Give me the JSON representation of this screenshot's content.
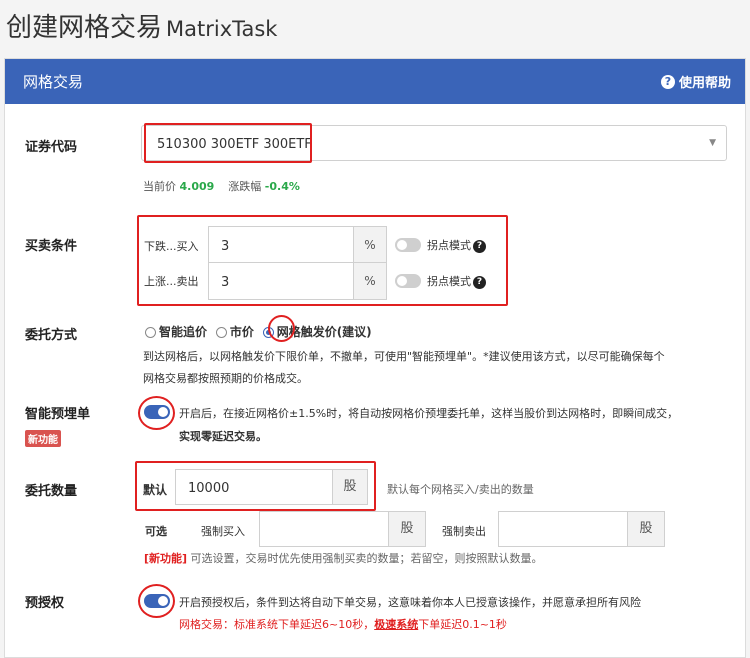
{
  "page": {
    "title_cn": "创建网格交易",
    "title_en": "MatrixTask"
  },
  "card": {
    "title": "网格交易",
    "help_label": "使用帮助"
  },
  "security": {
    "label": "证券代码",
    "value": "510300 300ETF 300ETF",
    "price_label": "当前价",
    "price": "4.009",
    "change_label": "涨跌幅",
    "change": "-0.4%"
  },
  "conditions": {
    "label": "买卖条件",
    "buy": {
      "label": "下跌...买入",
      "value": "3",
      "unit": "%",
      "mode_label": "拐点模式"
    },
    "sell": {
      "label": "上涨...卖出",
      "value": "3",
      "unit": "%",
      "mode_label": "拐点模式"
    }
  },
  "order_type": {
    "label": "委托方式",
    "options": [
      "智能追价",
      "市价",
      "网格触发价(建议)"
    ],
    "selected": 2,
    "desc1": "到达网格后，以网格触发价下限价单，不撤单，可使用\"智能预埋单\"。*建议使用该方式，以尽可能确保每个",
    "desc2": "网格交易都按照预期的价格成交。"
  },
  "smart": {
    "label": "智能预埋单",
    "badge": "新功能",
    "desc1": "开启后，在接近网格价±1.5%时，将自动按网格价预埋委托单，这样当股价到达网格时，即瞬间成交，",
    "desc2": "实现零延迟交易。",
    "enabled": true
  },
  "quantity": {
    "label": "委托数量",
    "default_label": "默认",
    "value": "10000",
    "unit": "股",
    "note": "默认每个网格买入/卖出的数量",
    "optional_label": "可选",
    "force_buy_label": "强制买入",
    "force_buy_value": "",
    "force_buy_unit": "股",
    "force_sell_label": "强制卖出",
    "force_sell_value": "",
    "force_sell_unit": "股",
    "tip_tag": "[新功能]",
    "tip": " 可选设置，交易时优先使用强制买卖的数量；若留空，则按照默认数量。"
  },
  "preauth": {
    "label": "预授权",
    "desc": "开启预授权后，条件到达将自动下单交易，这意味着你本人已授意该操作，并愿意承担所有风险",
    "note1": "网格交易：标准系统下单延迟6~10秒，",
    "note_link": "极速系统",
    "note2": "下单延迟0.1~1秒",
    "enabled": true
  },
  "colors": {
    "accent": "#3a64b8",
    "annotation": "#e02020",
    "positive": "#2aa84a"
  }
}
